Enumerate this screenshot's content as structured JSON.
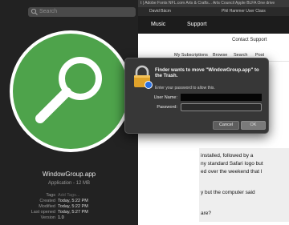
{
  "finder": {
    "search_placeholder": "Search",
    "app_name": "WindowGroup.app",
    "app_kind": "Application - 12 MB",
    "metadata": [
      {
        "label": "Tags",
        "value": "Add Tags...",
        "placeholder": true
      },
      {
        "label": "Created",
        "value": "Today, 5:22 PM"
      },
      {
        "label": "Modified",
        "value": "Today, 5:22 PM"
      },
      {
        "label": "Last opened",
        "value": "Today, 5:27 PM"
      },
      {
        "label": "Version",
        "value": "1.0"
      }
    ]
  },
  "browser": {
    "bookmarks": "t | Adobe Fonts   NFL.com   Arts & Crafts...   Arts Council   Apple   BLFA   One drive",
    "tabs": [
      "David Bäcm",
      "Phil Hammer User Class"
    ],
    "nav": [
      "Music",
      "Support"
    ],
    "contact_support": "Contact Support",
    "subnav": [
      "My Subscriptions",
      "Browse",
      "Search",
      "Post"
    ],
    "content_lines": [
      "installed, followed by a",
      "ny standard Safari logo but",
      "ed over the weekend that I",
      "y but the computer said",
      "are?"
    ]
  },
  "dialog": {
    "title": "Finder wants to move \"WindowGroup.app\" to the Trash.",
    "subtitle": "Enter your password to allow this.",
    "username_label": "User Name:",
    "password_label": "Password:",
    "cancel_label": "Cancel",
    "ok_label": "OK"
  },
  "colors": {
    "app_icon_green": "#4ea34b",
    "app_icon_ring": "#ffffff",
    "dialog_bg": "#373737"
  }
}
